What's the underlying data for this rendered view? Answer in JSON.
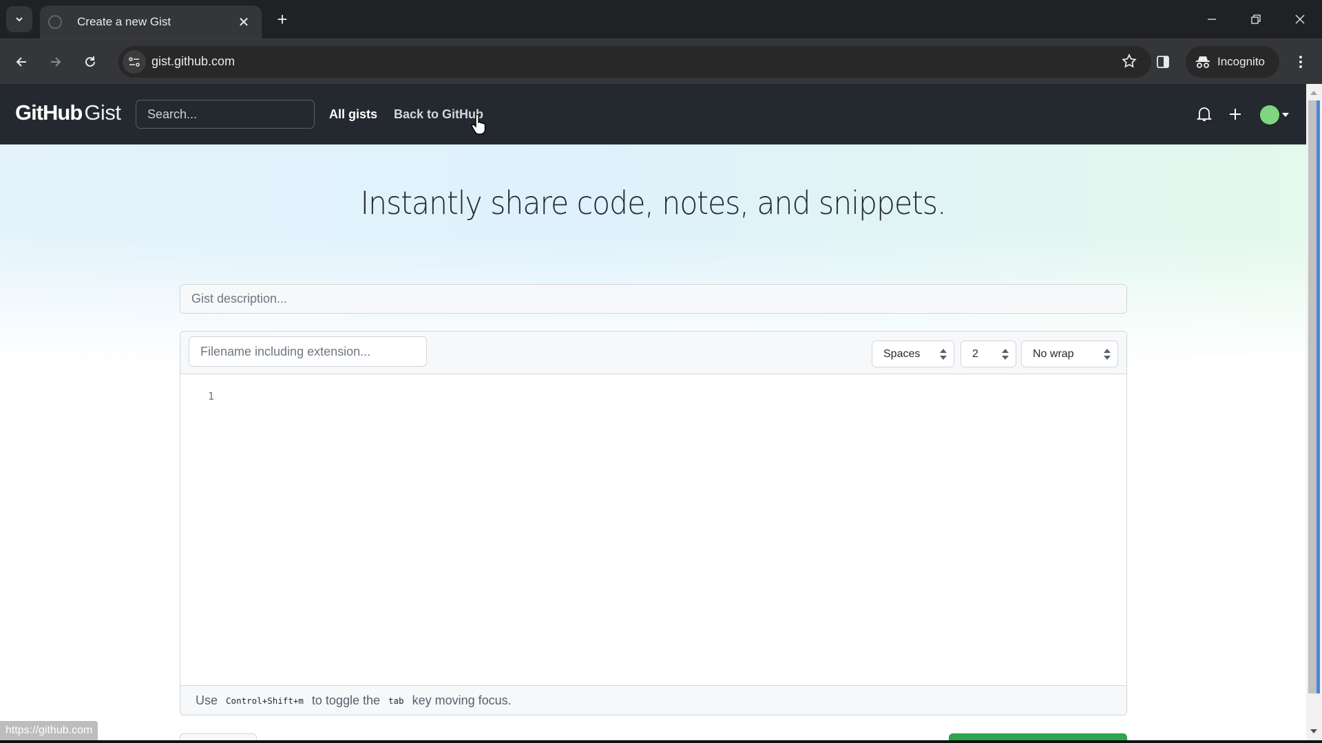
{
  "browser": {
    "tab": {
      "title": "Create a new Gist",
      "favicon": "github-icon"
    },
    "url": "gist.github.com",
    "incognito_label": "Incognito",
    "status_url": "https://github.com",
    "icons": [
      "tab-search-icon",
      "close-icon",
      "new-tab-icon",
      "minimize-icon",
      "restore-icon",
      "window-close-icon",
      "back-icon",
      "forward-icon",
      "reload-icon",
      "site-info-icon",
      "bookmark-star-icon",
      "side-panel-icon",
      "incognito-icon",
      "more-menu-icon"
    ]
  },
  "header": {
    "logo_bold": "GitHub",
    "logo_light": "Gist",
    "search_placeholder": "Search...",
    "nav": [
      "All gists",
      "Back to GitHub"
    ],
    "icons": [
      "notifications-bell-icon",
      "create-plus-icon",
      "avatar"
    ]
  },
  "hero": {
    "title": "Instantly share code, notes, and snippets."
  },
  "form": {
    "description_placeholder": "Gist description...",
    "description_value": "",
    "filename_placeholder": "Filename including extension...",
    "filename_value": "",
    "indent_mode": "Spaces",
    "indent_size": "2",
    "wrap_mode": "No wrap",
    "line_numbers": [
      "1"
    ],
    "hint": {
      "prefix": "Use",
      "shortcut": "Control+Shift+m",
      "middle": "to toggle the",
      "key": "tab",
      "suffix": "key moving focus."
    }
  },
  "colors": {
    "header_bg": "#24292f",
    "primary_button": "#2da44e",
    "avatar": "#7ed67e"
  }
}
